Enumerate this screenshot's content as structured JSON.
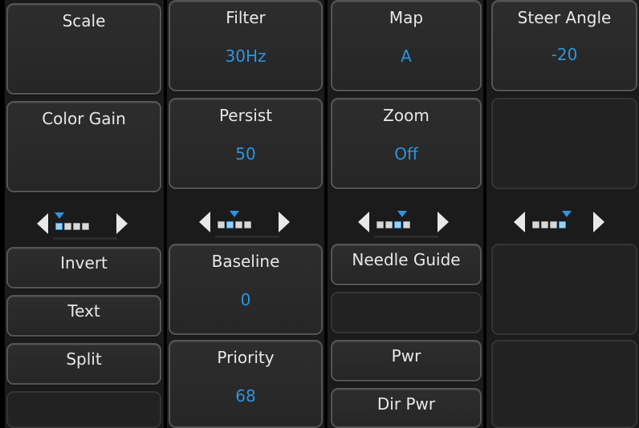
{
  "columns": [
    {
      "buttons": [
        {
          "label": "Scale",
          "value": ""
        },
        {
          "label": "Color Gain",
          "value": ""
        },
        {
          "label": "Invert"
        },
        {
          "label": "Text"
        },
        {
          "label": "Split"
        }
      ],
      "pager": {
        "page": 1,
        "pages": 4
      }
    },
    {
      "buttons": [
        {
          "label": "Filter",
          "value": "30Hz"
        },
        {
          "label": "Persist",
          "value": "50"
        },
        {
          "label": "Baseline",
          "value": "0"
        },
        {
          "label": "Priority",
          "value": "68"
        }
      ],
      "pager": {
        "page": 2,
        "pages": 4
      }
    },
    {
      "buttons": [
        {
          "label": "Map",
          "value": "A"
        },
        {
          "label": "Zoom",
          "value": "Off"
        },
        {
          "label": "Needle Guide"
        },
        {
          "label": "Pwr"
        },
        {
          "label": "Dir Pwr"
        }
      ],
      "pager": {
        "page": 3,
        "pages": 4
      }
    },
    {
      "buttons": [
        {
          "label": "Steer Angle",
          "value": "-20"
        }
      ],
      "pager": {
        "page": 4,
        "pages": 4
      }
    }
  ],
  "colors": {
    "accent": "#2b95e0",
    "text": "#e8e8e8",
    "background": "#1b1b1b"
  },
  "icons": {
    "left": "triangle-left-icon",
    "right": "triangle-right-icon",
    "page_dot": "square-dot-icon",
    "current_page": "caret-down-icon"
  }
}
